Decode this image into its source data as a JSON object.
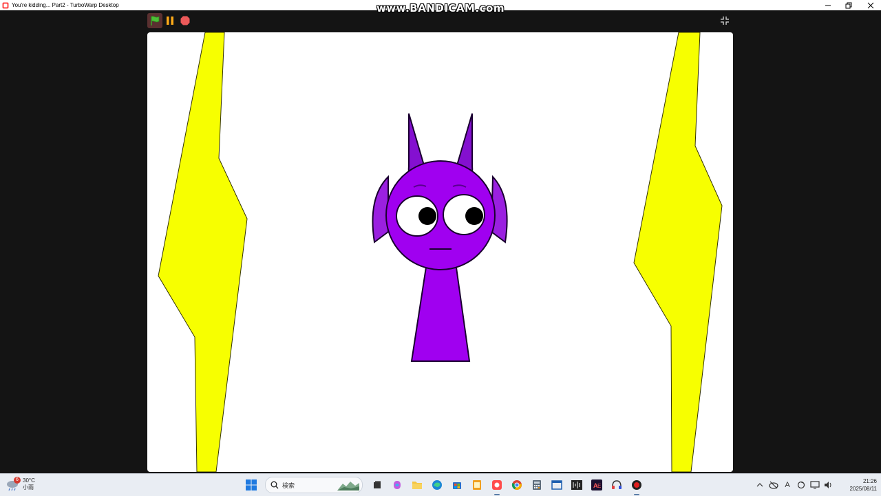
{
  "window": {
    "title": "You're kidding... Part2 - TurboWarp Desktop",
    "watermark": "www.BANDICAM.com"
  },
  "player": {
    "controls": [
      "green-flag",
      "pause",
      "stop"
    ]
  },
  "stage": {
    "colors": {
      "background": "#ffffff",
      "lightning": "#f7ff00",
      "body": "#a000f0",
      "horn": "#7a10c0",
      "outline": "#1a0030"
    }
  },
  "taskbar": {
    "weather": {
      "badge": "6",
      "temp": "30°C",
      "condition": "小雨"
    },
    "search_placeholder": "検索",
    "apps": [
      "start-icon",
      "search",
      "file-manager-icon",
      "copilot-icon",
      "folder-icon",
      "edge-icon",
      "store-icon",
      "notes-icon",
      "turbowarp-icon",
      "chrome-icon",
      "calculator-icon",
      "window-icon",
      "audio-editor-icon",
      "adobe-icon",
      "headphones-icon",
      "record-icon"
    ],
    "tray": {
      "ime": "A"
    },
    "clock": {
      "time": "21:26",
      "date": "2025/08/11"
    }
  }
}
